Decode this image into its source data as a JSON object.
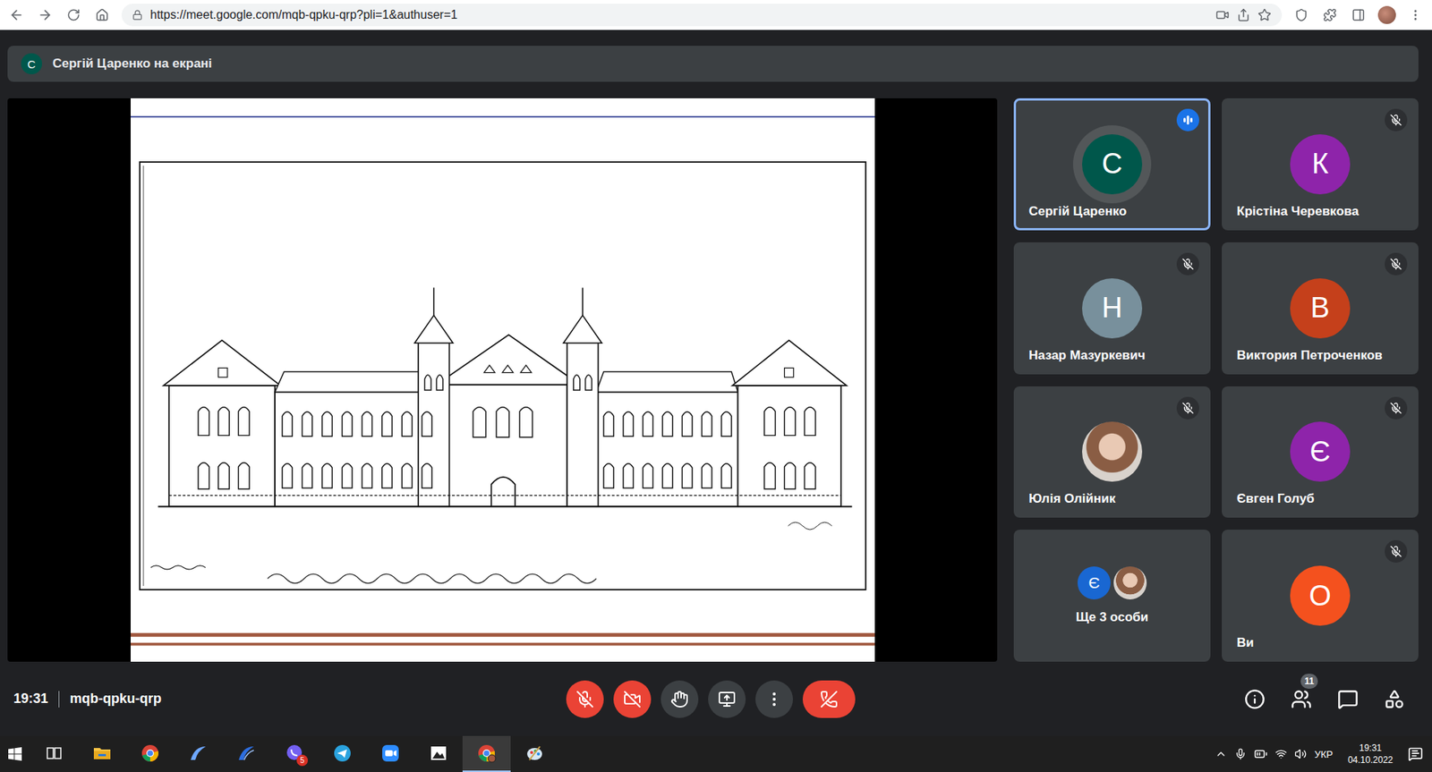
{
  "browser": {
    "url": "https://meet.google.com/mqb-qpku-qrp?pli=1&authuser=1"
  },
  "presenting_banner": {
    "avatar": "С",
    "avatar_color": "#00574b",
    "text": "Сергій Царенко на екрані"
  },
  "participants": [
    {
      "name": "Сергій Царенко",
      "kind": "letter",
      "avatar": "С",
      "color": "#00574b",
      "speaking": true,
      "muted": false
    },
    {
      "name": "Крістіна Черевкова",
      "kind": "letter",
      "avatar": "К",
      "color": "#8e24aa",
      "speaking": false,
      "muted": true
    },
    {
      "name": "Назар Мазуркевич",
      "kind": "letter",
      "avatar": "Н",
      "color": "#78909c",
      "speaking": false,
      "muted": true
    },
    {
      "name": "Виктория Петроченков",
      "kind": "letter",
      "avatar": "В",
      "color": "#c5401b",
      "speaking": false,
      "muted": true
    },
    {
      "name": "Юлія Олійник",
      "kind": "photo",
      "speaking": false,
      "muted": true
    },
    {
      "name": "Євген Голуб",
      "kind": "letter",
      "avatar": "Є",
      "color": "#8e24aa",
      "speaking": false,
      "muted": true
    },
    {
      "name": "Ще 3 особи",
      "kind": "group",
      "avatars": [
        {
          "kind": "letter",
          "letter": "Є",
          "color": "#1967d2"
        },
        {
          "kind": "photo"
        }
      ],
      "speaking": false,
      "muted": false
    },
    {
      "name": "Ви",
      "kind": "letter",
      "avatar": "О",
      "color": "#f4511e",
      "speaking": false,
      "muted": true
    }
  ],
  "meeting": {
    "time": "19:31",
    "code": "mqb-qpku-qrp"
  },
  "controls": [
    {
      "kind": "mic",
      "off": true
    },
    {
      "kind": "camera",
      "off": true
    },
    {
      "kind": "hand",
      "off": false
    },
    {
      "kind": "present",
      "off": false
    },
    {
      "kind": "more",
      "off": false
    },
    {
      "kind": "leave",
      "off": false
    }
  ],
  "side_buttons": [
    {
      "kind": "info"
    },
    {
      "kind": "people",
      "badge": "11"
    },
    {
      "kind": "chat"
    },
    {
      "kind": "activities"
    }
  ],
  "taskbar": {
    "apps": [
      {
        "kind": "task-view",
        "active": false
      },
      {
        "kind": "file-explorer",
        "active": false
      },
      {
        "kind": "chrome",
        "active": false
      },
      {
        "kind": "arc-light",
        "active": false
      },
      {
        "kind": "arc-dark",
        "active": false
      },
      {
        "kind": "viber",
        "active": false,
        "badge": "5"
      },
      {
        "kind": "telegram",
        "active": false
      },
      {
        "kind": "zoom",
        "active": false
      },
      {
        "kind": "photos",
        "active": false
      },
      {
        "kind": "chrome-profile",
        "active": true
      },
      {
        "kind": "paint",
        "active": false
      }
    ],
    "language": "УКР",
    "time": "19:31",
    "date": "04.10.2022"
  }
}
